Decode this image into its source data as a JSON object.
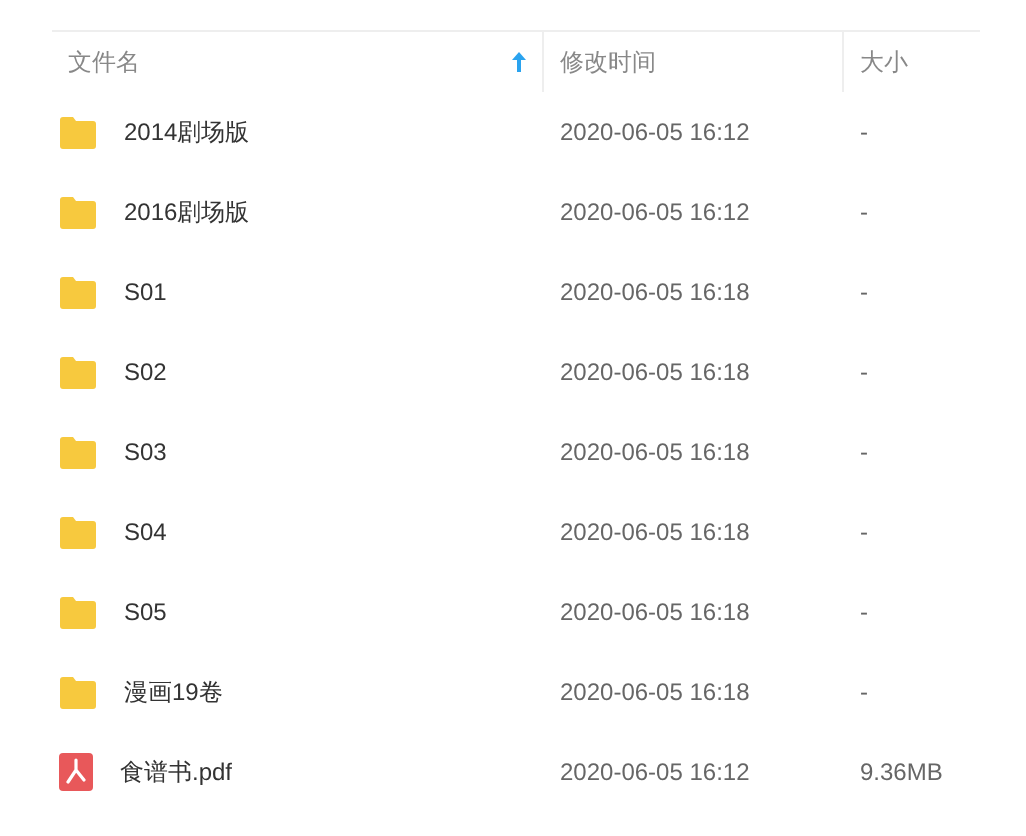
{
  "columns": [
    {
      "label": "文件名",
      "sorted": true
    },
    {
      "label": "修改时间",
      "sorted": false
    },
    {
      "label": "大小",
      "sorted": false
    }
  ],
  "rows": [
    {
      "kind": "folder",
      "name": "2014剧场版",
      "modified": "2020-06-05 16:12",
      "size": "-"
    },
    {
      "kind": "folder",
      "name": "2016剧场版",
      "modified": "2020-06-05 16:12",
      "size": "-"
    },
    {
      "kind": "folder",
      "name": "S01",
      "modified": "2020-06-05 16:18",
      "size": "-"
    },
    {
      "kind": "folder",
      "name": "S02",
      "modified": "2020-06-05 16:18",
      "size": "-"
    },
    {
      "kind": "folder",
      "name": "S03",
      "modified": "2020-06-05 16:18",
      "size": "-"
    },
    {
      "kind": "folder",
      "name": "S04",
      "modified": "2020-06-05 16:18",
      "size": "-"
    },
    {
      "kind": "folder",
      "name": "S05",
      "modified": "2020-06-05 16:18",
      "size": "-"
    },
    {
      "kind": "folder",
      "name": "漫画19卷",
      "modified": "2020-06-05 16:18",
      "size": "-"
    },
    {
      "kind": "pdf",
      "name": "食谱书.pdf",
      "modified": "2020-06-05 16:12",
      "size": "9.36MB"
    }
  ]
}
